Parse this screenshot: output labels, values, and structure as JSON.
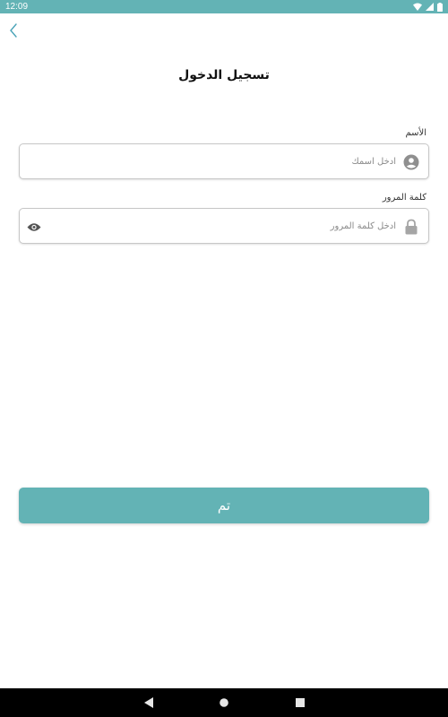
{
  "status_bar": {
    "time": "12:09"
  },
  "header": {
    "title": "تسجيل الدخول"
  },
  "form": {
    "name_label": "الأسم",
    "name_placeholder": "ادخل اسمك",
    "name_value": "",
    "password_label": "كلمة المرور",
    "password_placeholder": "ادخل كلمة المرور",
    "password_value": ""
  },
  "submit": {
    "label": "تم"
  },
  "icons": {
    "back": "chevron-left-icon",
    "user": "account-circle-icon",
    "lock": "lock-icon",
    "visibility": "eye-icon",
    "wifi": "wifi-icon",
    "signal": "signal-icon",
    "battery": "battery-icon",
    "nav_back": "triangle-back-icon",
    "nav_home": "circle-home-icon",
    "nav_recents": "square-recents-icon"
  },
  "colors": {
    "accent": "#63b3b5",
    "nav_bar": "#000000",
    "icon_gray": "#8f8f8f"
  }
}
